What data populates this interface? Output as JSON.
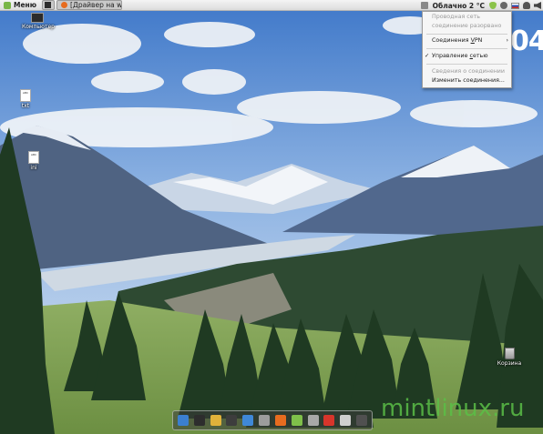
{
  "top_panel": {
    "menu_label": "Меню",
    "tasks": [
      {
        "label": "",
        "icon": "terminal-icon"
      },
      {
        "label": "[Драйвер на wi...",
        "icon": "firefox-icon"
      }
    ],
    "tray": {
      "weather_label": "Облачно 2 °C",
      "volume_icon": "speaker-icon"
    }
  },
  "network_menu": {
    "wired_header": "Проводная сеть",
    "wired_status": "соединение разорвано",
    "vpn_pre": "Соединения ",
    "vpn_u": "V",
    "vpn_post": "PN",
    "manage_pre": "Управление ",
    "manage_u": "с",
    "manage_post": "етью",
    "manage_checked": true,
    "info_label": "Сведения о соединении",
    "edit_label": "Изменить соединения..."
  },
  "wallpaper_text": "04",
  "desktop": {
    "icons": [
      {
        "label": "Компьютер",
        "kind": "computer-icon"
      },
      {
        "label": "txt",
        "kind": "text-file-icon",
        "badge": "ABC"
      },
      {
        "label": "ini",
        "kind": "text-file-icon",
        "badge": "ABC"
      },
      {
        "label": "Корзина",
        "kind": "trash-icon"
      }
    ]
  },
  "dock": {
    "items": [
      {
        "name": "dock-anchor-icon",
        "color": "#3b7fd0"
      },
      {
        "name": "dock-terminal-icon",
        "color": "#2d2d2d"
      },
      {
        "name": "dock-chrome-icon",
        "color": "#e0b23a"
      },
      {
        "name": "dock-monitor-icon",
        "color": "#3d3d3d"
      },
      {
        "name": "dock-writer-icon",
        "color": "#3f88d8"
      },
      {
        "name": "dock-calc-icon",
        "color": "#9c9c9c"
      },
      {
        "name": "dock-firefox-icon",
        "color": "#e76c1f"
      },
      {
        "name": "dock-files-icon",
        "color": "#7fbf4a"
      },
      {
        "name": "dock-grid-icon",
        "color": "#a8a8a8"
      },
      {
        "name": "dock-app-red-icon",
        "color": "#d8352b"
      },
      {
        "name": "dock-editor-icon",
        "color": "#cfcfcf"
      },
      {
        "name": "dock-settings-icon",
        "color": "#505050"
      }
    ]
  },
  "watermark": "mintlinux.ru",
  "colors": {
    "sky": "#5a8fd6",
    "watermark": "#5abe46"
  }
}
